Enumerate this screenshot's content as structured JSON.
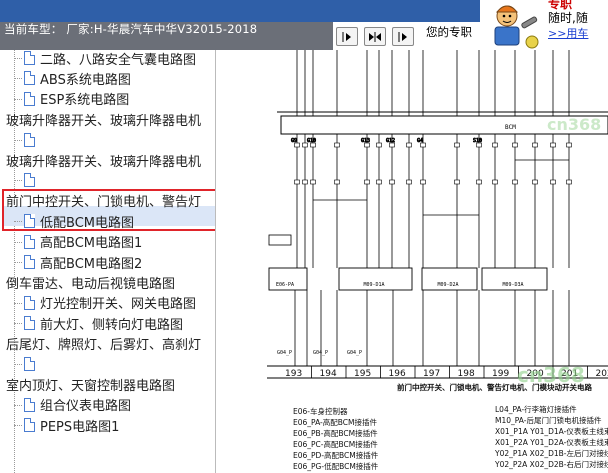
{
  "header": {
    "vehicle_label": "当前车型： 厂家:H-华晨汽车中华V32015-2018",
    "exclusive_label": "您的专职",
    "nav_buttons": [
      "prev",
      "expand",
      "next"
    ],
    "ad": {
      "title": "专职",
      "line2": "随时,随",
      "link": ">>用车"
    }
  },
  "sidebar": {
    "items": [
      {
        "label": "二路、八路安全气囊电路图",
        "icon": "doc-icon",
        "indent": 1
      },
      {
        "label": "ABS系统电路图",
        "icon": "doc-icon",
        "indent": 1
      },
      {
        "label": "ESP系统电路图",
        "icon": "doc-icon",
        "indent": 1
      },
      {
        "label": "玻璃升降器开关、玻璃升降器电机",
        "icon": "",
        "indent": 0
      },
      {
        "label": "",
        "icon": "doc-icon",
        "indent": 1
      },
      {
        "label": "玻璃升降器开关、玻璃升降器电机",
        "icon": "",
        "indent": 0
      },
      {
        "label": "",
        "icon": "doc-icon",
        "indent": 1
      },
      {
        "label": "前门中控开关、门锁电机、警告灯",
        "icon": "",
        "indent": 0,
        "selected": true
      },
      {
        "label": "低配BCM电路图",
        "icon": "doc-icon",
        "indent": 1
      },
      {
        "label": "高配BCM电路图1",
        "icon": "doc-icon",
        "indent": 1
      },
      {
        "label": "高配BCM电路图2",
        "icon": "doc-icon",
        "indent": 1
      },
      {
        "label": "倒车雷达、电动后视镜电路图",
        "icon": "",
        "indent": 0
      },
      {
        "label": "灯光控制开关、网关电路图",
        "icon": "doc-icon",
        "indent": 1
      },
      {
        "label": "前大灯、侧转向灯电路图",
        "icon": "doc-icon",
        "indent": 1
      },
      {
        "label": "后尾灯、牌照灯、后雾灯、高刹灯",
        "icon": "",
        "indent": 0
      },
      {
        "label": "",
        "icon": "doc-icon",
        "indent": 1
      },
      {
        "label": "室内顶灯、天窗控制器电路图",
        "icon": "",
        "indent": 0
      },
      {
        "label": "组合仪表电路图",
        "icon": "doc-icon",
        "indent": 1
      },
      {
        "label": "PEPS电路图1",
        "icon": "doc-icon",
        "indent": 1
      }
    ]
  },
  "diagram": {
    "bottom_numbers": [
      "193",
      "194",
      "195",
      "196",
      "197",
      "198",
      "199",
      "200",
      "201",
      "202"
    ],
    "title": "前门中控开关、门锁电机、警告灯电机、门模块动开关电路",
    "connectors": [
      "E06-PA",
      "M09-D1A",
      "M09-D2A",
      "M09-D3A"
    ],
    "bus_label": "BCM",
    "ground_labels": [
      "G04_P",
      "G04_P",
      "G04_P"
    ],
    "legend_left": [
      "E06-车身控制器",
      "E06_PA-高配BCM接插件",
      "E06_PB-高配BCM接插件",
      "E06_PC-高配BCM接插件",
      "E06_PD-高配BCM接插件",
      "E06_PG-低配BCM接插件"
    ],
    "legend_right": [
      "L04_PA-行李箱灯接插件",
      "M10_PA-后尾门门锁电机接插件",
      "X01_P1A Y01_D1A-仪表板主线束",
      "X01_P2A Y01_D2A-仪表板主线束",
      "Y02_P1A X02_D1B-左后门对接线束",
      "Y02_P2A X02_D2B-右后门对接线束"
    ],
    "watermark": "cn368",
    "top_pin_labels": [
      "G9",
      "G10",
      "G13",
      "G12",
      "G4",
      "S10"
    ]
  },
  "colors": {
    "header_band": "#2f5fa8",
    "vehicle_bar": "#6b6f78",
    "highlight": "#e0242a",
    "link": "#1a3fd0",
    "ad_red": "#c00000",
    "watermark": "#8fd08a"
  }
}
